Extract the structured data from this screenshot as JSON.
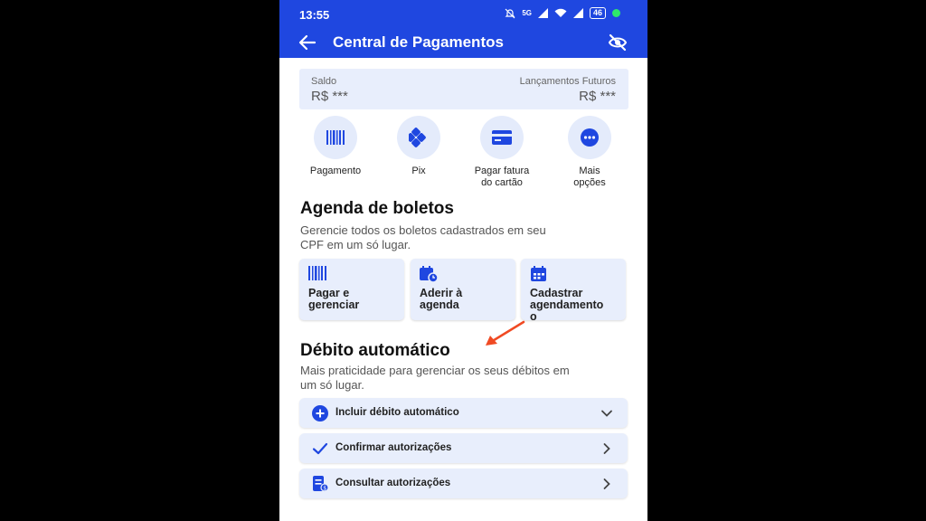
{
  "status": {
    "time": "13:55",
    "network": "5G",
    "battery": "46"
  },
  "header": {
    "title": "Central de Pagamentos"
  },
  "balance": {
    "left_label": "Saldo",
    "left_value": "R$ ***",
    "right_label": "Lançamentos Futuros",
    "right_value": "R$ ***"
  },
  "quick_actions": [
    {
      "line1": "Pagamento",
      "line2": ""
    },
    {
      "line1": "Pix",
      "line2": ""
    },
    {
      "line1": "Pagar fatura",
      "line2": "do cartão"
    },
    {
      "line1": "Mais",
      "line2": "opções"
    }
  ],
  "agenda": {
    "title": "Agenda de boletos",
    "description": "Gerencie todos os boletos cadastrados em seu CPF em um só lugar.",
    "cards": [
      {
        "line1": "Pagar e",
        "line2": "gerenciar"
      },
      {
        "line1": "Aderir à",
        "line2": "agenda"
      },
      {
        "line1": "Cadastrar",
        "line2": "agendamento",
        "line3": "o"
      }
    ]
  },
  "debito": {
    "title": "Débito automático",
    "description": "Mais praticidade para gerenciar os seus débitos em um só lugar.",
    "rows": [
      {
        "label": "Incluir débito automático"
      },
      {
        "label": "Confirmar autorizações"
      },
      {
        "label": "Consultar autorizações"
      }
    ]
  },
  "colors": {
    "primary": "#1f47e0",
    "card_bg": "#e8eefc",
    "arrow": "#f04a23"
  }
}
